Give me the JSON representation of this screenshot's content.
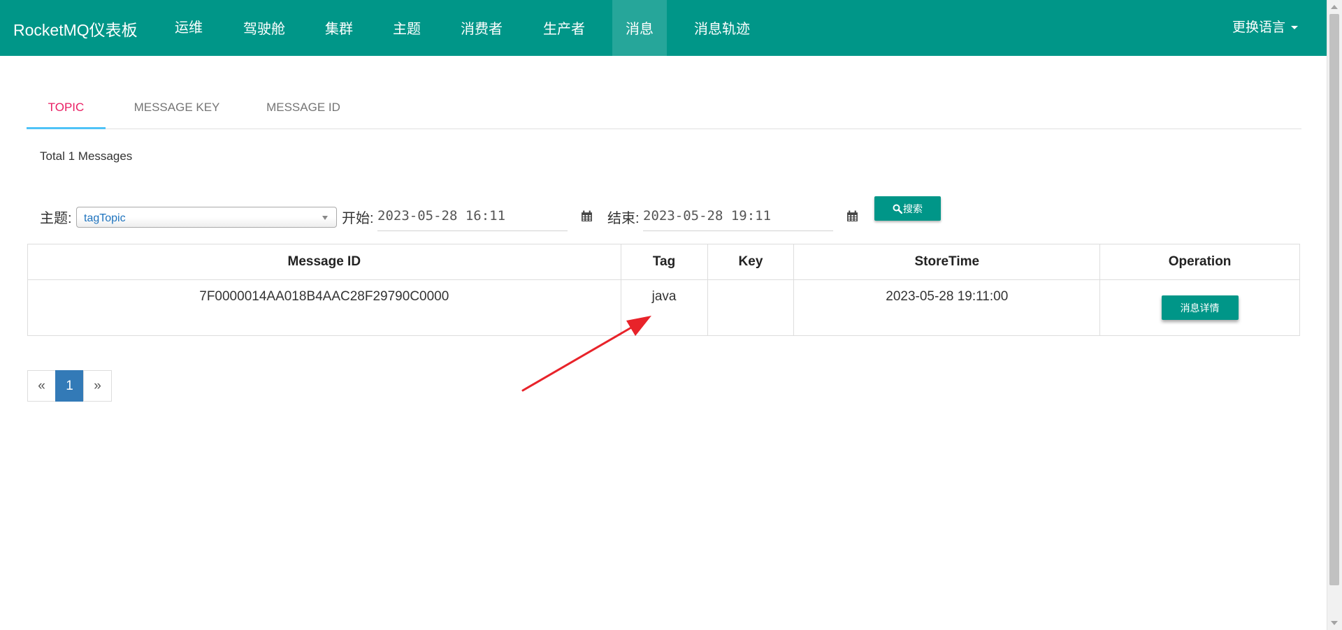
{
  "navbar": {
    "brand": "RocketMQ仪表板",
    "items": [
      {
        "label": "运维"
      },
      {
        "label": "驾驶舱"
      },
      {
        "label": "集群"
      },
      {
        "label": "主题"
      },
      {
        "label": "消费者"
      },
      {
        "label": "生产者"
      },
      {
        "label": "消息",
        "active": true
      },
      {
        "label": "消息轨迹"
      }
    ],
    "language_menu": "更换语言"
  },
  "tabs": [
    {
      "label": "TOPIC",
      "active": true
    },
    {
      "label": "MESSAGE KEY"
    },
    {
      "label": "MESSAGE ID"
    }
  ],
  "summary": "Total 1 Messages",
  "filters": {
    "topic_label": "主题:",
    "topic_value": "tagTopic",
    "begin_label": "开始:",
    "begin_value": "2023-05-28 16:11",
    "end_label": "结束:",
    "end_value": "2023-05-28 19:11",
    "search_button": "搜索"
  },
  "table": {
    "headers": [
      "Message ID",
      "Tag",
      "Key",
      "StoreTime",
      "Operation"
    ],
    "rows": [
      {
        "message_id": "7F0000014AA018B4AAC28F29790C0000",
        "tag": "java",
        "key": "",
        "store_time": "2023-05-28 19:11:00",
        "operation": "消息详情"
      }
    ]
  },
  "pagination": {
    "prev": "«",
    "current": "1",
    "next": "»"
  },
  "annotation": {
    "color": "#e8232a"
  },
  "colors": {
    "primary": "#009688",
    "active_tab_text": "#e91e63",
    "tab_indicator": "#4fc3f7",
    "page_active": "#337ab7"
  }
}
